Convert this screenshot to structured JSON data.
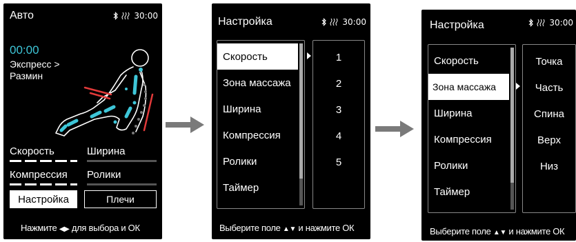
{
  "status": {
    "bluetooth_icon": "bluetooth-icon",
    "heat_icon": "heat-icon",
    "timer": "30:00"
  },
  "screen1": {
    "title": "Авто",
    "time": "00:00",
    "program_line1": "Экспресс >",
    "program_line2": "Размин",
    "speed_label": "Скорость",
    "width_label": "Ширина",
    "compression_label": "Компрессия",
    "rollers_label": "Ролики",
    "settings_button": "Настройка",
    "shoulders_button": "Плечи",
    "hint_before": "Нажмите",
    "hint_after": "для выбора и ОК"
  },
  "screen2": {
    "title": "Настройка",
    "menu": [
      "Скорость",
      "Зона массажа",
      "Ширина",
      "Компрессия",
      "Ролики",
      "Таймер"
    ],
    "selected_index": 0,
    "values": [
      "1",
      "2",
      "3",
      "4",
      "5"
    ],
    "hint_before": "Выберите поле",
    "hint_after": "и нажмите ОК"
  },
  "screen3": {
    "title": "Настройка",
    "menu": [
      "Скорость",
      "Зона массажа",
      "Ширина",
      "Компрессия",
      "Ролики",
      "Таймер"
    ],
    "selected_index": 1,
    "values": [
      "Точка",
      "Часть",
      "Спина",
      "Верх",
      "Низ"
    ],
    "hint_before": "Выберите поле",
    "hint_after": "и нажмите ОК"
  },
  "flow_arrow_icon": "arrow-right-icon"
}
